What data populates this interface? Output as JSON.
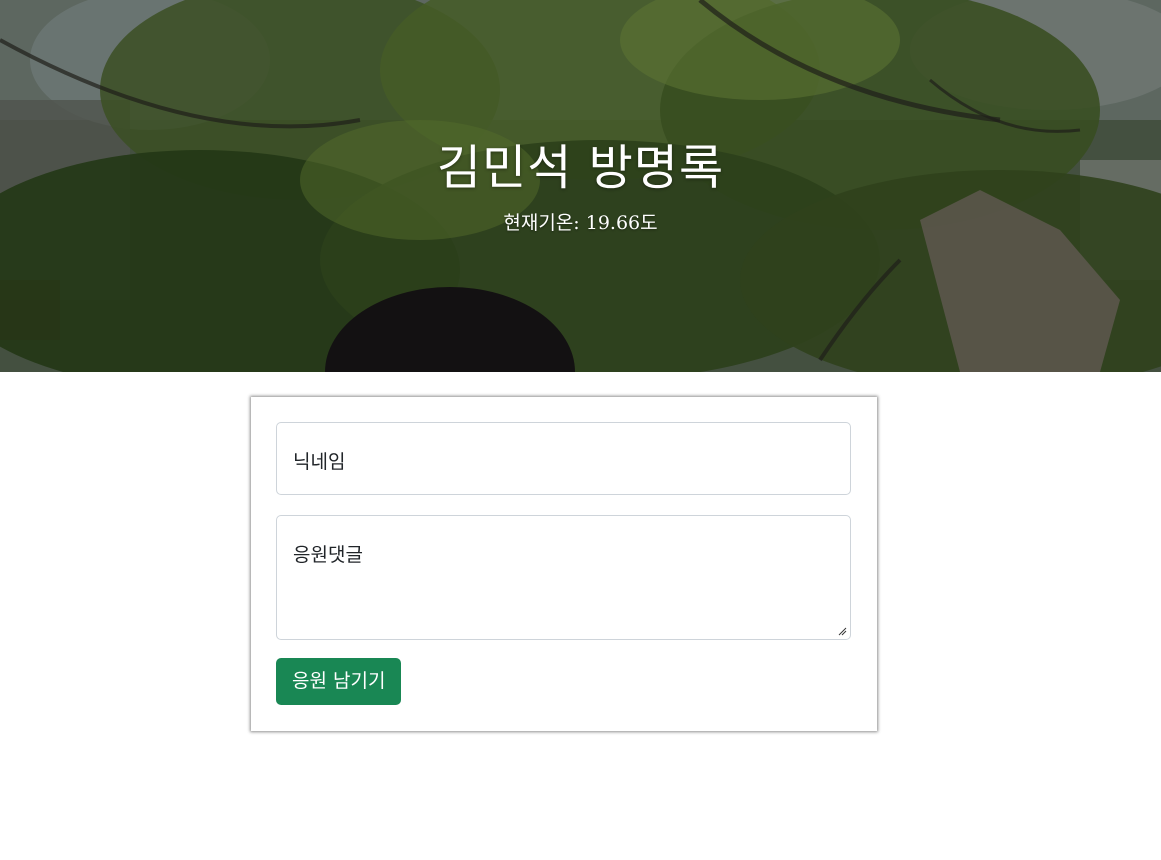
{
  "header": {
    "title": "김민석 방명록",
    "temperature": "현재기온: 19.66도"
  },
  "form": {
    "nickname_placeholder": "닉네임",
    "comment_placeholder": "응원댓글",
    "submit_label": "응원 남기기"
  },
  "colors": {
    "submit_button": "#198754",
    "field_border": "#ced4da"
  }
}
